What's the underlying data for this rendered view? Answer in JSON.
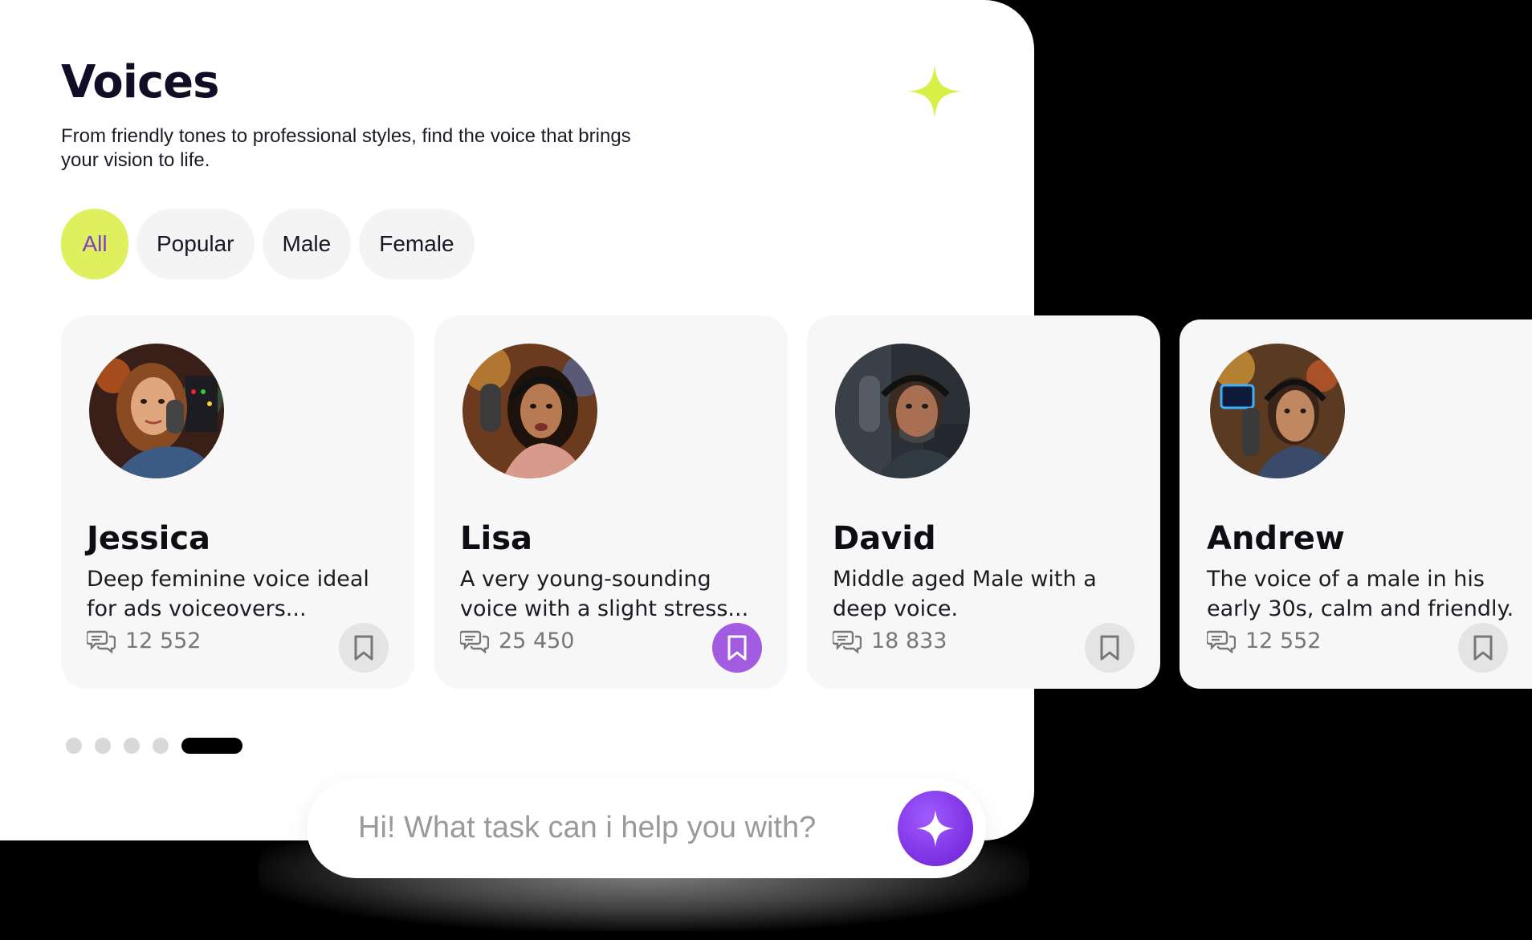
{
  "header": {
    "title": "Voices",
    "subtitle": "From friendly tones to professional styles, find the voice that brings your vision to life.",
    "decor_icon": "sparkle-icon",
    "accent_color": "#dff05f"
  },
  "filters": [
    {
      "label": "All",
      "active": true
    },
    {
      "label": "Popular",
      "active": false
    },
    {
      "label": "Male",
      "active": false
    },
    {
      "label": "Female",
      "active": false
    }
  ],
  "voices": [
    {
      "name": "Jessica",
      "description": "Deep feminine voice ideal for ads voiceovers...",
      "count": "12 552",
      "saved": false,
      "avatar_icon": "avatar-jessica"
    },
    {
      "name": "Lisa",
      "description": "A very young-sounding voice with a slight stress...",
      "count": "25 450",
      "saved": true,
      "avatar_icon": "avatar-lisa"
    },
    {
      "name": "David",
      "description": "Middle aged Male with a deep voice.",
      "count": "18 833",
      "saved": false,
      "avatar_icon": "avatar-david"
    },
    {
      "name": "Andrew",
      "description": "The voice of a male in his early 30s, calm and friendly.",
      "count": "12 552",
      "saved": false,
      "avatar_icon": "avatar-andrew"
    }
  ],
  "pagination": {
    "total": 5,
    "active_index": 4
  },
  "chat": {
    "placeholder": "Hi! What task can i help you with?",
    "send_icon": "sparkle-icon",
    "send_color": "#7b2fe0"
  },
  "colors": {
    "saved_bookmark": "#a35be0",
    "chip_bg": "#f4f4f4",
    "chip_active_text": "#7b3fc8"
  }
}
